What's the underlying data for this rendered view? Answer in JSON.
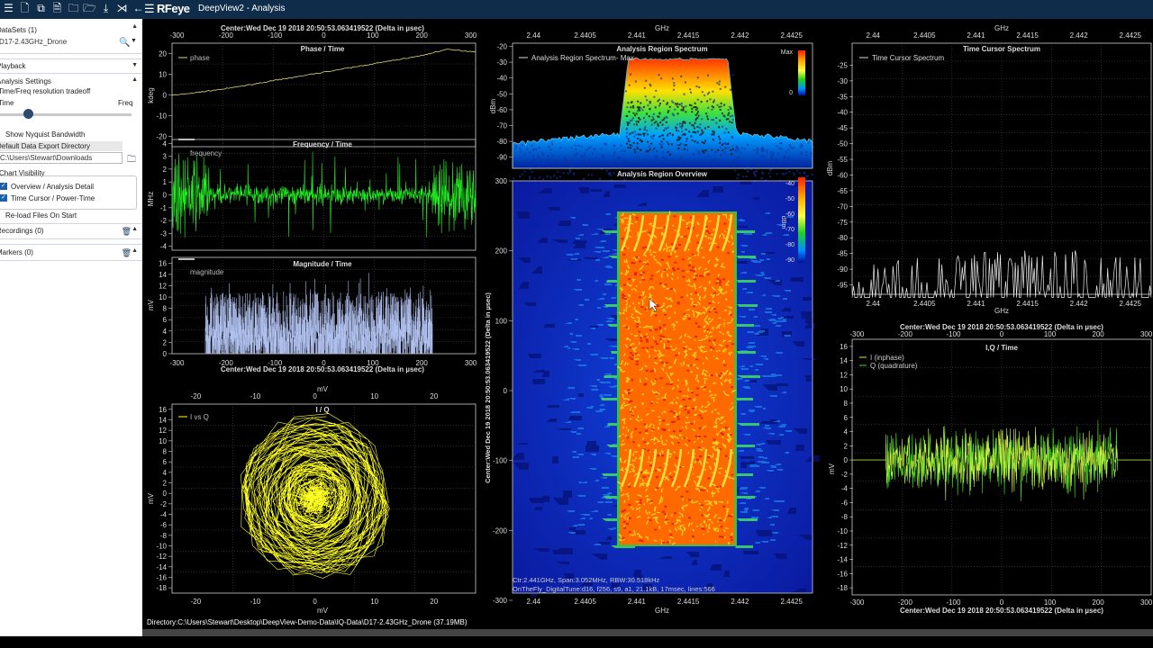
{
  "titlebar": {
    "brand_rf": "RF",
    "brand_eye": "eye",
    "app_title": "DeepView2 - Analysis",
    "icons": [
      "list-icon",
      "file-icon",
      "copy-icon",
      "folder-icon",
      "folder-open-icon",
      "download-icon",
      "collapse-icon",
      "back-icon"
    ]
  },
  "sidebar": {
    "datasets_label": "DataSets (1)",
    "dataset_value": "D17-2.43GHz_Drone",
    "playback_label": "Playback",
    "analysis_settings_label": "Analysis Settings",
    "tradeoff_label": "Time/Freq resolution tradeoff",
    "time_label": "Time",
    "freq_label": "Freq",
    "slider_value": 0.2,
    "nyquist_label": "Show Nyquist Bandwidth",
    "export_dir_label": "Default Data Export Directory",
    "export_dir_value": "C:\\Users\\Stewart\\Downloads",
    "chart_visibility_label": "Chart Visibility",
    "overview_label": "Overview / Analysis Detail",
    "timecursor_label": "Time Cursor / Power-Time",
    "reload_label": "Re-load Files On Start",
    "recordings_label": "Recordings (0)",
    "markers_label": "Markers (0)"
  },
  "status": {
    "directory": "Directory:C:\\Users\\Stewart\\Desktop\\DeepView-Demo-Data\\IQ-Data\\D17-2.43GHz_Drone (37.19MB)"
  },
  "colors": {
    "accent": "#1d5fa8",
    "phase": "#d9d97a",
    "frequency": "#22ee22",
    "magnitude": "#b0c0ee",
    "iq": "#ffff22",
    "inphase": "#cfee44",
    "quadrature": "#44dd22"
  },
  "chart_data": [
    {
      "type": "line",
      "title": "Phase / Time",
      "top_label": "Center:Wed Dec 19 2018 20:50:53.063419522 (Delta in µsec)",
      "ylabel": "kdeg",
      "legend": "phase",
      "x_ticks": [
        -300,
        -200,
        -100,
        0,
        100,
        200,
        300
      ],
      "xlim": [
        -310,
        310
      ],
      "y_ticks": [
        -20,
        -10,
        0,
        10,
        20
      ],
      "ylim": [
        -25,
        25
      ],
      "series": [
        {
          "name": "phase",
          "x": [
            -300,
            -200,
            -100,
            0,
            100,
            200,
            250,
            300
          ],
          "values": [
            0,
            3,
            7,
            11,
            15,
            19,
            22,
            21
          ]
        }
      ]
    },
    {
      "type": "line",
      "title": "Frequency / Time",
      "ylabel": "MHz",
      "legend": "frequency",
      "y_ticks": [
        -4,
        -3,
        -2,
        -1,
        0,
        1,
        2,
        3,
        4
      ],
      "ylim": [
        -4.3,
        4.3
      ]
    },
    {
      "type": "line",
      "title": "Magnitude / Time",
      "bottom_label": "Center:Wed Dec 19 2018 20:50:53.063419522 (Delta in µsec)",
      "ylabel": "mV",
      "legend": "magnitude",
      "y_ticks": [
        0,
        2,
        4,
        6,
        8,
        10,
        12,
        14,
        16
      ],
      "ylim": [
        0,
        17
      ],
      "x_ticks": [
        -300,
        -200,
        -100,
        0,
        100,
        200,
        300
      ],
      "xlim": [
        -310,
        310
      ]
    },
    {
      "type": "scatter",
      "title": "I / Q",
      "xlabel": "mV",
      "ylabel": "mV",
      "legend": "I vs Q",
      "x_ticks": [
        -20,
        -10,
        0,
        10,
        20
      ],
      "xlim": [
        -24,
        27
      ],
      "y_ticks": [
        -18,
        -16,
        -14,
        -12,
        -10,
        -8,
        -6,
        -4,
        -2,
        0,
        2,
        4,
        6,
        8,
        10,
        12,
        14,
        16
      ],
      "ylim": [
        -19,
        17
      ]
    },
    {
      "type": "area",
      "title": "Analysis Region Spectrum",
      "top_label": "GHz",
      "ylabel": "dBm",
      "legend": "Analysis Region Spectrum- Max",
      "x_ticks": [
        "2.44",
        "2.4405",
        "2.441",
        "2.4415",
        "2.442",
        "2.4425"
      ],
      "y_ticks": [
        -20,
        -30,
        -40,
        -50,
        -60,
        -70,
        -80,
        -90
      ],
      "ylim": [
        -97,
        -18
      ],
      "colorbar": {
        "top": "Max",
        "bottom": "0"
      }
    },
    {
      "type": "heatmap",
      "title": "Analysis Region Overview",
      "ylabel": "Center:Wed Dec 19 2018 20:50:53.063419522 (Delta in µsec)",
      "bottom_label": "GHz",
      "x_ticks": [
        "2.44",
        "2.4405",
        "2.441",
        "2.4415",
        "2.442",
        "2.4425"
      ],
      "y_ticks": [
        -300,
        -200,
        -100,
        0,
        100,
        200,
        300
      ],
      "ylim": [
        -300,
        300
      ],
      "colorbar": {
        "unit": "dBm",
        "ticks": [
          -40,
          -50,
          -60,
          -70,
          -80,
          -90
        ]
      },
      "info1": "Ctr:2.441GHz, Span:3.052MHz, RBW:30.518kHz",
      "info2": "OnTheFly_DigitalTune:d16, f256, s9, a1, 21.1kB, 17msec, lines:566"
    },
    {
      "type": "line",
      "title": "Time Cursor Spectrum",
      "xlabel": "GHz",
      "ylabel": "dBm",
      "legend": "Time Cursor Spectrum",
      "x_ticks": [
        "2.44",
        "2.4405",
        "2.441",
        "2.4415",
        "2.442",
        "2.4425"
      ],
      "y_ticks": [
        -25,
        -30,
        -35,
        -40,
        -45,
        -50,
        -55,
        -60,
        -65,
        -70,
        -75,
        -80,
        -85,
        -90,
        -95
      ],
      "ylim": [
        -98,
        -18
      ]
    },
    {
      "type": "line",
      "title": "I,Q / Time",
      "top_label": "Center:Wed Dec 19 2018 20:50:53.063419522 (Delta in µsec)",
      "bottom_label": "Center:Wed Dec 19 2018 20:50:53.063419522 (Delta in µsec)",
      "ylabel": "mV",
      "x_ticks": [
        -300,
        -200,
        -100,
        0,
        100,
        200,
        300
      ],
      "xlim": [
        -310,
        310
      ],
      "y_ticks": [
        -18,
        -16,
        -14,
        -12,
        -10,
        -8,
        -6,
        -4,
        -2,
        0,
        2,
        4,
        6,
        8,
        10,
        12,
        14,
        16
      ],
      "ylim": [
        -19,
        17
      ],
      "series": [
        {
          "name": "I (inphase)"
        },
        {
          "name": "Q (quadrature)"
        }
      ]
    }
  ]
}
